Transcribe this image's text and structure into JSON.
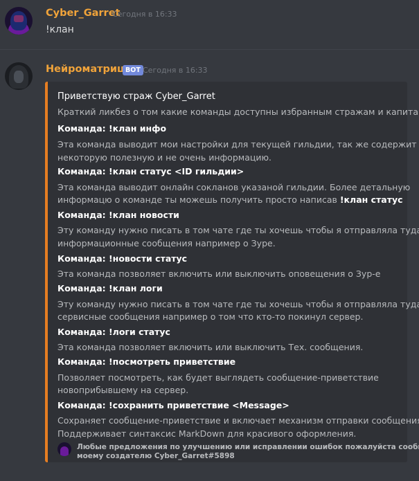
{
  "message1": {
    "author": "Cyber_Garret",
    "timestamp": "Сегодня в 16:33",
    "text": "!клан"
  },
  "message2": {
    "author": "Нейроматрица",
    "badge": "BOT",
    "timestamp": "Сегодня в 16:33",
    "embed": {
      "accent_color": "#e67e22",
      "title": "Приветствую страж Cyber_Garret",
      "description": "Краткий ликбез о том какие команды доступны избранным стражам и капитану.",
      "fields": [
        {
          "prefix": "Команда: ",
          "command": "!клан инфо",
          "lines": [
            "Эта команда выводит мои настройки для текущей гильдии, так же содержит",
            "некоторую полезную и не очень информацию."
          ]
        },
        {
          "prefix": "Команда: ",
          "command": "!клан статус <ID гильдии>",
          "lines": [
            "Эта команда выводит онлайн сокланов указаной гильдии. Более детальную",
            "информацю о команде ты можешь получить просто написав "
          ],
          "bold_tail": "!клан статус"
        },
        {
          "prefix": "Команда: ",
          "command": "!клан новости",
          "lines": [
            "Эту команду нужно писать в том чате где ты хочешь чтобы я отправляла туда",
            "информационные сообщения например о Зуре."
          ]
        },
        {
          "prefix": "Команда: ",
          "command": "!новости статус",
          "lines": [
            "Эта команда позволяет включить или выключить оповещения о Зур-е"
          ]
        },
        {
          "prefix": "Команда: ",
          "command": "!клан логи",
          "lines": [
            "Эту команду нужно писать в том чате где ты хочешь чтобы я отправляла туда",
            "сервисные сообщения например о том что кто-то покинул сервер."
          ]
        },
        {
          "prefix": "Команда: ",
          "command": "!логи статус",
          "lines": [
            "Эта команда позволяет включить или выключить Тех. сообщения."
          ]
        },
        {
          "prefix": "Команда: ",
          "command": "!посмотреть приветствие",
          "lines": [
            "Позволяет посмотреть, как будет выглядеть сообщение-приветствие",
            "новоприбывшему на сервер."
          ]
        },
        {
          "prefix": "Команда: ",
          "command": "!сохранить приветствие <Message>",
          "lines": [
            "Сохраняет сообщение-приветствие и включает механизм отправки сообщения.",
            "Поддерживает синтаксис MarkDown для красивого оформления."
          ]
        }
      ],
      "footer": [
        "Любые предложения по улучшению или исправлении ошибок пожалуйста сообщи",
        "моему создателю Cyber_Garret#5898"
      ]
    }
  }
}
